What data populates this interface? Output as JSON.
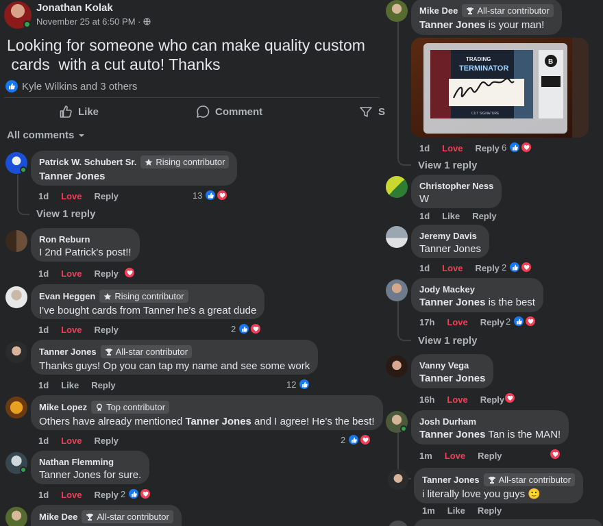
{
  "post": {
    "author": "Jonathan Kolak",
    "date": "November 25 at 6:50 PM · ",
    "text": "Looking for someone who can make quality custom\n cards  with a cut auto! Thanks",
    "reactions_text": "Kyle Wilkins and 3 others",
    "actions": {
      "like": "Like",
      "comment": "Comment",
      "share": "S"
    },
    "filter_label": "All comments"
  },
  "comments_left": [
    {
      "name": "Patrick W. Schubert Sr.",
      "badge": "Rising contributor",
      "text": "Tanner Jones",
      "time": "1d",
      "reaction": "Love",
      "reply": "Reply",
      "count": "13",
      "view_reply": "View 1 reply"
    },
    {
      "name": "Ron Reburn",
      "text": "I 2nd Patrick's post!!",
      "time": "1d",
      "reaction": "Love",
      "reply": "Reply"
    },
    {
      "name": "Evan Heggen",
      "badge": "Rising contributor",
      "text": "I've bought cards from Tanner he's a great dude",
      "time": "1d",
      "reaction": "Love",
      "reply": "Reply",
      "count": "2"
    },
    {
      "name": "Tanner Jones",
      "badge": "All-star contributor",
      "text": "Thanks guys! Op you can tap my name and see some work",
      "time": "1d",
      "reaction": "Like",
      "reply": "Reply",
      "count": "12"
    },
    {
      "name": "Mike Lopez",
      "badge": "Top contributor",
      "text_pre": "Others have already mentioned ",
      "text_bold": "Tanner Jones",
      "text_post": " and I agree! He's the best!",
      "time": "1d",
      "reaction": "Love",
      "reply": "Reply",
      "count": "2"
    },
    {
      "name": "Nathan Flemming",
      "text": "Tanner Jones for sure.",
      "time": "1d",
      "reaction": "Love",
      "reply": "Reply",
      "count": "2"
    },
    {
      "name": "Mike Dee",
      "badge": "All-star contributor"
    }
  ],
  "comments_right": [
    {
      "name": "Mike Dee",
      "badge": "All-star contributor",
      "text_bold": "Tanner Jones",
      "text_post": " is your man!",
      "time": "1d",
      "reaction": "Love",
      "reply": "Reply",
      "count": "6",
      "view_reply": "View 1 reply"
    },
    {
      "name": "Christopher Ness",
      "text": "W",
      "time": "1d",
      "reaction": "Like",
      "reply": "Reply"
    },
    {
      "name": "Jeremy Davis",
      "text": "Tanner Jones",
      "time": "1d",
      "reaction": "Love",
      "reply": "Reply",
      "count": "2"
    },
    {
      "name": "Jody Mackey",
      "text_bold": "Tanner Jones",
      "text_post": " is the best",
      "time": "17h",
      "reaction": "Love",
      "reply": "Reply",
      "count": "2",
      "view_reply": "View 1 reply"
    },
    {
      "name": "Vanny Vega",
      "text_bold": "Tanner Jones",
      "time": "16h",
      "reaction": "Love",
      "reply": "Reply"
    },
    {
      "name": "Josh Durham",
      "text_bold": "Tanner Jones",
      "text_post": " Tan is the MAN!",
      "time": "1m",
      "reaction": "Love",
      "reply": "Reply"
    },
    {
      "name": "Tanner Jones",
      "badge": "All-star contributor",
      "text": "i literally love you guys ",
      "emoji": "🙂",
      "time": "1m",
      "reaction": "Like",
      "reply": "Reply"
    }
  ],
  "card_image": {
    "top_text": "TRADING",
    "mid_text": "TERMINATOR",
    "sig_text": "CUT SIGNATURE",
    "slab_text": "B"
  },
  "colors": {
    "background": "#242526",
    "bubble": "#3a3b3c",
    "love": "#f33e58",
    "like": "#1877f2",
    "online": "#31a24c"
  }
}
